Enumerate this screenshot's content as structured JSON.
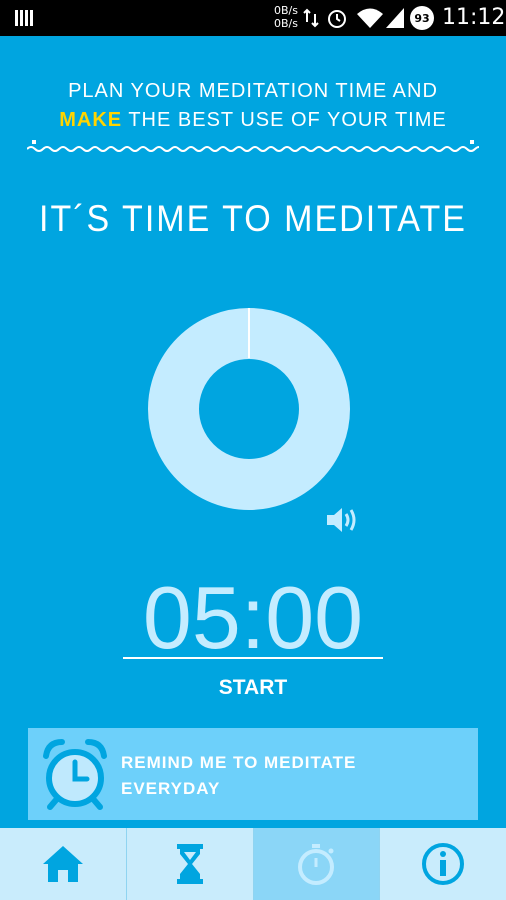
{
  "status_bar": {
    "net_up": "0B/s",
    "net_down": "0B/s",
    "battery": "93",
    "time": "11:12"
  },
  "banner": {
    "line1": "PLAN YOUR MEDITATION TIME AND",
    "line2_accent": "MAKE",
    "line2_rest": " THE BEST USE OF YOUR TIME"
  },
  "main": {
    "title": "IT´S TIME TO MEDITATE",
    "timer": "05:00",
    "progress": 0.0,
    "start_label": "START"
  },
  "reminder": {
    "line1": "REMIND ME TO MEDITATE",
    "line2": "EVERYDAY"
  },
  "bottom_nav": [
    {
      "icon": "home-icon"
    },
    {
      "icon": "hourglass-icon"
    },
    {
      "icon": "stopwatch-icon",
      "active": true
    },
    {
      "icon": "info-icon"
    }
  ],
  "colors": {
    "background": "#00a5e0",
    "accent": "#ffd400",
    "donut": "#c4ecff",
    "reminder_bg": "#6dd0fa",
    "nav_bg": "#c9ecfc",
    "nav_active": "#8bd6f7"
  }
}
